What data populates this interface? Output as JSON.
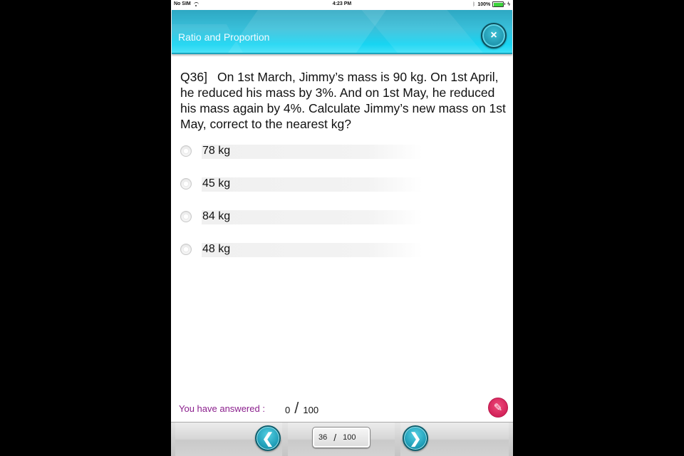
{
  "status_bar": {
    "carrier": "No SIM",
    "time": "4:23 PM",
    "battery_percent": "100%",
    "icons": [
      "wifi-icon",
      "bluetooth-icon",
      "battery-icon",
      "charging-icon"
    ]
  },
  "header": {
    "title": "Ratio and Proportion",
    "close_icon": "×"
  },
  "question": {
    "number": "Q36]",
    "text": "On 1st March, Jimmy’s mass is 90 kg.  On 1st April, he reduced his mass by 3%. And on 1st May, he reduced his mass again by 4%.  Calculate Jimmy’s new mass on 1st May, correct to the nearest kg?"
  },
  "options": [
    {
      "label": "78 kg",
      "selected": false
    },
    {
      "label": "45 kg",
      "selected": false
    },
    {
      "label": "84 kg",
      "selected": false
    },
    {
      "label": "48 kg",
      "selected": false
    }
  ],
  "progress": {
    "label": "You have answered :",
    "answered": "0",
    "separator": "/",
    "total": "100"
  },
  "pen_icon": "✎",
  "toolbar": {
    "prev_icon": "❮",
    "next_icon": "❯",
    "current_page": "36",
    "separator": "/",
    "total_pages": "100"
  },
  "colors": {
    "header_accent": "#27c8e4",
    "answered_label": "#8b1f8d",
    "pen_button": "#d01e56",
    "nav_button": "#1e9cb6"
  }
}
